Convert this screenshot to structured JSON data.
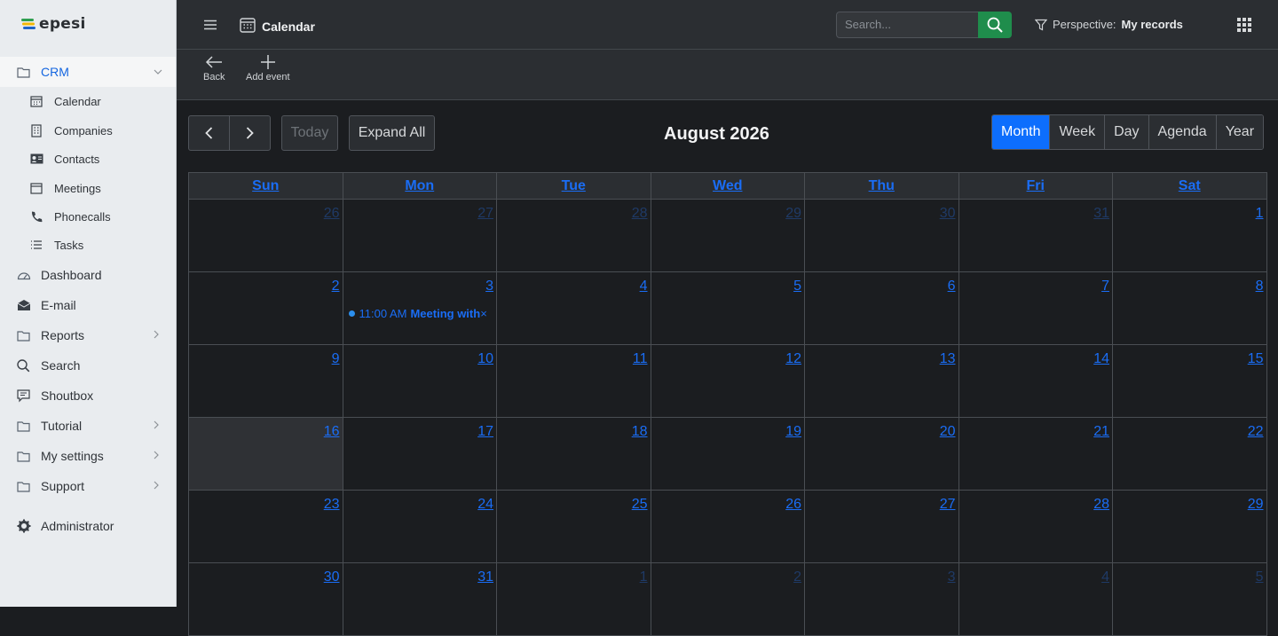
{
  "app": {
    "logo": "epesi"
  },
  "sidebar": {
    "crm": "CRM",
    "sub": [
      "Calendar",
      "Companies",
      "Contacts",
      "Meetings",
      "Phonecalls",
      "Tasks"
    ],
    "items": [
      "Dashboard",
      "E-mail",
      "Reports",
      "Search",
      "Shoutbox",
      "Tutorial",
      "My settings",
      "Support"
    ],
    "admin": "Administrator"
  },
  "header": {
    "title": "Calendar",
    "search_placeholder": "Search...",
    "perspective_label": "Perspective:",
    "perspective_value": "My records"
  },
  "toolbar": {
    "back": "Back",
    "add_event": "Add event"
  },
  "calendar": {
    "today": "Today",
    "expand_all": "Expand All",
    "month_title": "August 2026",
    "views": [
      "Month",
      "Week",
      "Day",
      "Agenda",
      "Year"
    ],
    "active_view": "Month",
    "weekdays": [
      "Sun",
      "Mon",
      "Tue",
      "Wed",
      "Thu",
      "Fri",
      "Sat"
    ],
    "weeks": [
      [
        "26",
        "27",
        "28",
        "29",
        "30",
        "31",
        "1"
      ],
      [
        "2",
        "3",
        "4",
        "5",
        "6",
        "7",
        "8"
      ],
      [
        "9",
        "10",
        "11",
        "12",
        "13",
        "14",
        "15"
      ],
      [
        "16",
        "17",
        "18",
        "19",
        "20",
        "21",
        "22"
      ],
      [
        "23",
        "24",
        "25",
        "26",
        "27",
        "28",
        "29"
      ],
      [
        "30",
        "31",
        "1",
        "2",
        "3",
        "4",
        "5"
      ]
    ],
    "event": {
      "time": "11:00 AM",
      "title": "Meeting with",
      "close": "×"
    }
  }
}
